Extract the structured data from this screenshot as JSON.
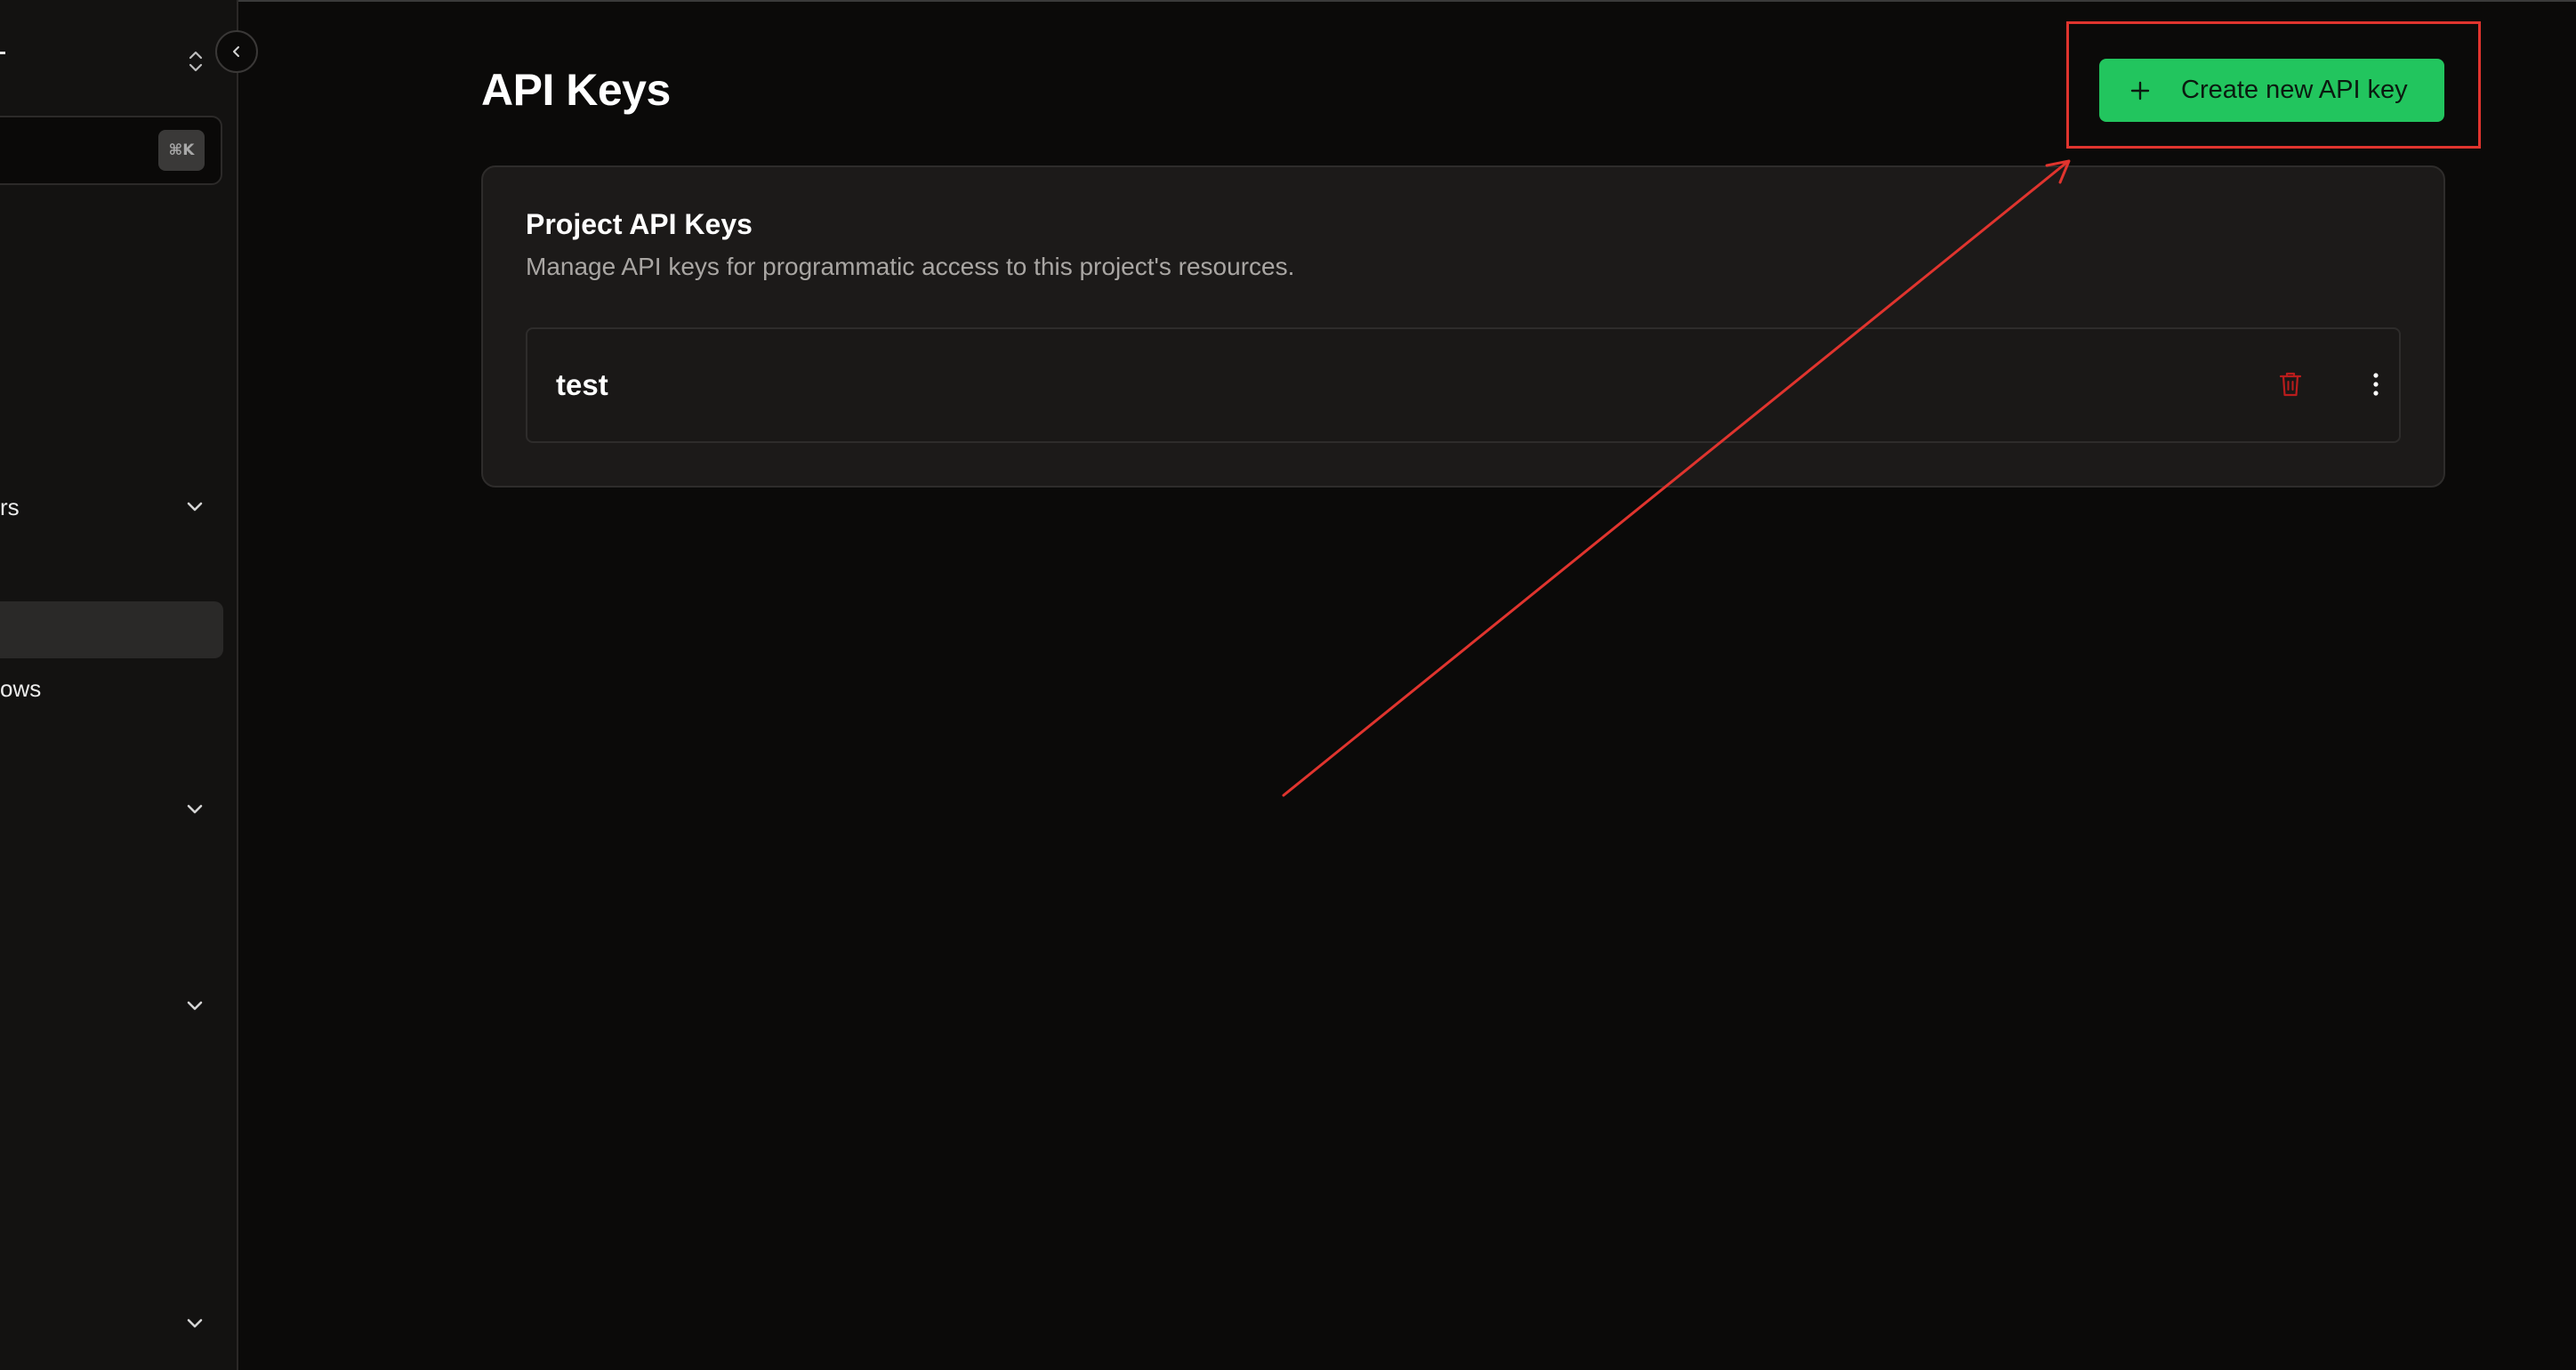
{
  "sidebar": {
    "search_shortcut": "⌘K",
    "items": [
      {
        "label": "rs",
        "has_chevron": true
      },
      {
        "label": "",
        "active": true
      },
      {
        "label": "ows",
        "has_chevron": false
      },
      {
        "label": "",
        "has_chevron": true
      },
      {
        "label": "",
        "has_chevron": true
      },
      {
        "label": "",
        "has_chevron": true
      }
    ],
    "collapse_icon": "chevron-left-icon"
  },
  "main": {
    "title": "API Keys",
    "create_button_label": "Create new API key",
    "create_button_icon": "plus-icon",
    "card": {
      "title": "Project API Keys",
      "description": "Manage API keys for programmatic access to this project's resources.",
      "keys": [
        {
          "name": "test"
        }
      ]
    }
  },
  "colors": {
    "background": "#0b0a09",
    "accent_green": "#22c55e",
    "annotation_red": "#e0342e",
    "danger": "#b91c1c"
  }
}
